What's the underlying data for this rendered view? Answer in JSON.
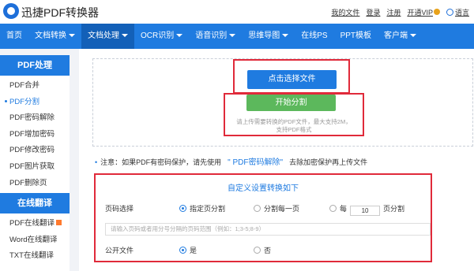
{
  "header": {
    "brand": "迅捷PDF转换器",
    "links": [
      "我的文件",
      "登录",
      "注册",
      "开通VIP"
    ],
    "language": "语言"
  },
  "nav": {
    "items": [
      {
        "label": "首页",
        "caret": false
      },
      {
        "label": "文档转换",
        "caret": true
      },
      {
        "label": "文档处理",
        "caret": true,
        "active": true
      },
      {
        "label": "OCR识别",
        "caret": true
      },
      {
        "label": "语音识别",
        "caret": true
      },
      {
        "label": "思维导图",
        "caret": true
      },
      {
        "label": "在线PS",
        "caret": false
      },
      {
        "label": "PPT模板",
        "caret": false
      },
      {
        "label": "客户端",
        "caret": true
      }
    ]
  },
  "sidebar": {
    "section1_title": "PDF处理",
    "section1_items": [
      "PDF合并",
      "PDF分割",
      "PDF密码解除",
      "PDF增加密码",
      "PDF修改密码",
      "PDF图片获取",
      "PDF删除页"
    ],
    "section2_title": "在线翻译",
    "section2_items": [
      "PDF在线翻译",
      "Word在线翻译",
      "TXT在线翻译"
    ]
  },
  "upload": {
    "select_button": "点击选择文件",
    "start_button": "开始分割",
    "hint_line1": "请上传需要转换的PDF文件，最大支持2M，",
    "hint_line2": "支持PDF格式"
  },
  "notice": {
    "prefix": "注意：如果PDF有密码保护，请先使用",
    "link": "\" PDF密码解除\"",
    "suffix": "去除加密保护再上传文件"
  },
  "settings": {
    "title": "自定义设置转换如下",
    "page_select_label": "页码选择",
    "opt_specified": "指定页分割",
    "opt_each": "分割每一页",
    "opt_every_prefix": "每",
    "every_value": "10",
    "opt_every_suffix": "页分割",
    "range_placeholder": "请输入页码或者用分号分隔的页码范围（例如：1;3-5;8-9）",
    "public_label": "公开文件",
    "public_yes": "是",
    "public_no": "否"
  },
  "colors": {
    "primary": "#1f7be0",
    "nav_active": "#1360b8",
    "start_button": "#5cb85c",
    "highlight": "#e02a3a"
  }
}
